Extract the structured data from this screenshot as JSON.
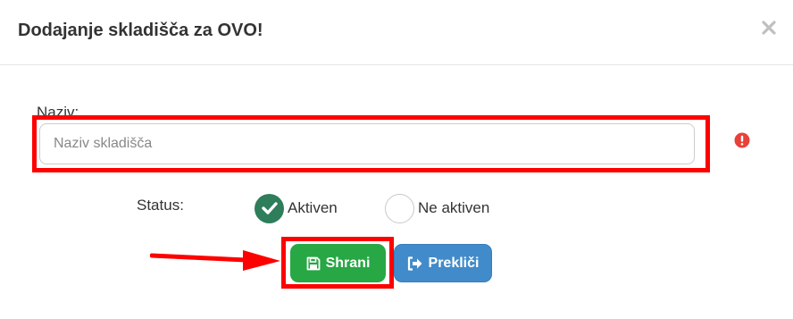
{
  "modal": {
    "title": "Dodajanje skladišča za OVO!",
    "close_icon": "close-icon"
  },
  "form": {
    "name_label": "Naziv:",
    "name_value": "",
    "name_placeholder": "Naziv skladišča",
    "error_icon": "exclamation-circle-icon",
    "status_label": "Status:",
    "status_options": [
      {
        "label": "Aktiven",
        "checked": true
      },
      {
        "label": "Ne aktiven",
        "checked": false
      }
    ]
  },
  "buttons": {
    "save_label": "Shrani",
    "cancel_label": "Prekliči"
  },
  "colors": {
    "highlight": "#ff0000",
    "save": "#28a745",
    "cancel": "#428bca",
    "checked_radio": "#2e7d5b",
    "error": "#e8413a"
  }
}
